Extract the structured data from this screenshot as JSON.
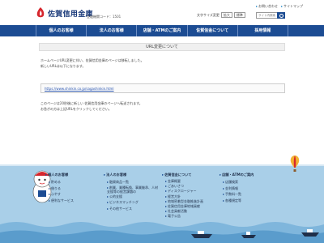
{
  "header": {
    "logo_name": "佐賀信用金庫",
    "bank_code": "金融機関コード：1501",
    "util_links": [
      "お問い合わせ",
      "サイトマップ"
    ],
    "text_size_label": "文字サイズ変更",
    "text_size_buttons": [
      "拡大",
      "標準"
    ],
    "search_placeholder": "サイト内検索"
  },
  "nav": {
    "items": [
      "個人のお客様",
      "法人のお客様",
      "店舗・ATMのご案内",
      "佐賀信金について",
      "採用情報"
    ]
  },
  "page": {
    "title": "URL変更について",
    "intro_lines": [
      "ホームページURL変更に伴い、佐賀信用金庫のページは移転しました。",
      "新しいURLは以下になります。"
    ],
    "new_url": "https://www.shinkin.co.jp/sagashinkin.html",
    "redirect_lines": [
      "このページは20秒後に新しい 佐賀信用金庫のページへ転送されます。",
      "お急ぎの方は上記URLをクリックしてください。"
    ]
  },
  "footer": {
    "columns": [
      {
        "head": "個人のお客様",
        "items": [
          "貯める",
          "借りる",
          "ふやす",
          "便利なサービス"
        ]
      },
      {
        "head": "法人のお客様",
        "items": [
          "融資商品一覧",
          "創業、業種転換、事業継承、人材支援等の経営課題の",
          "公的支援",
          "ビジネスマッチング",
          "その他サービス"
        ]
      },
      {
        "head": "佐賀信金について",
        "items": [
          "金庫概要",
          "ごあいさつ",
          "ディスクロージャー",
          "経営方針",
          "地域密着型金融推進計画",
          "佐賀信用金庫地域貢献",
          "社会貢献活動",
          "電子公告"
        ]
      },
      {
        "head": "店舗・ATMのご案内",
        "items": [
          "店舗検索",
          "金利情報",
          "手数料一覧",
          "各種規定等"
        ]
      }
    ]
  }
}
